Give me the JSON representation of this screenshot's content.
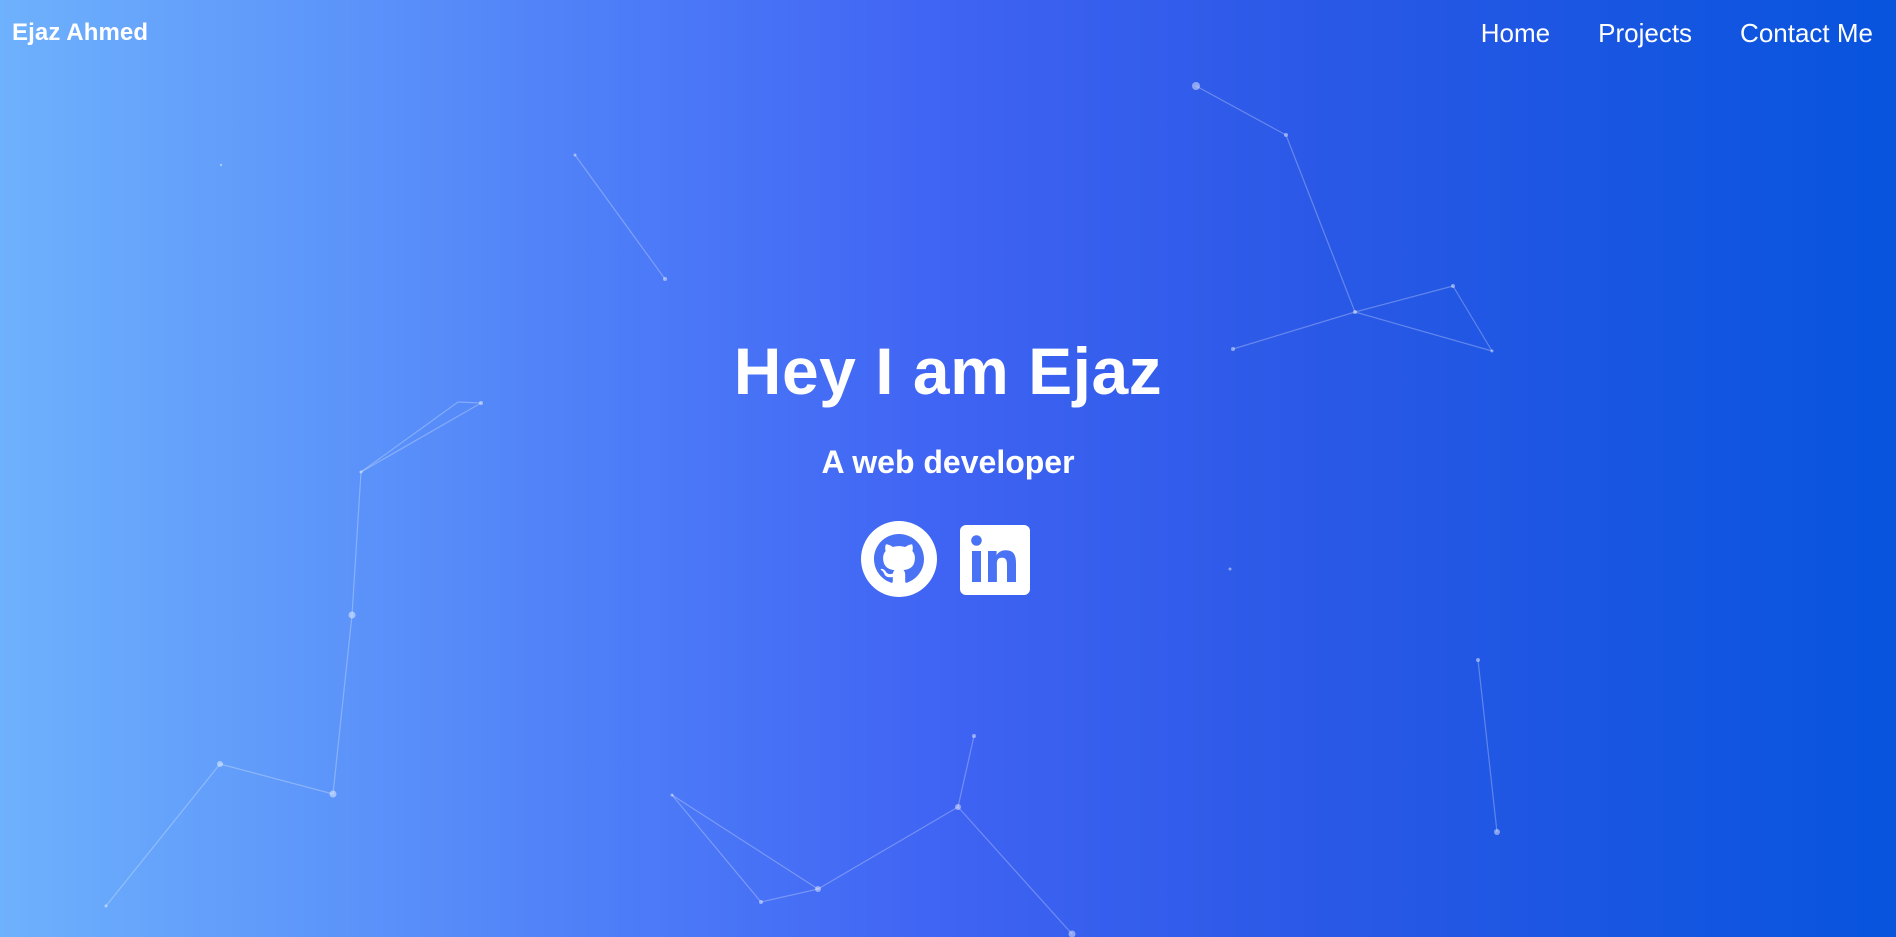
{
  "nav": {
    "brand": "Ejaz Ahmed",
    "links": [
      "Home",
      "Projects",
      "Contact Me"
    ]
  },
  "hero": {
    "headline": "Hey I am Ejaz",
    "tagline": "A web developer"
  },
  "socials": [
    {
      "icon": "github-icon"
    },
    {
      "icon": "linkedin-icon"
    }
  ],
  "colors": {
    "gradient_start": "#6eb1fc",
    "gradient_mid": "#3f63f3",
    "gradient_end": "#0754dd",
    "text": "#ffffff"
  }
}
